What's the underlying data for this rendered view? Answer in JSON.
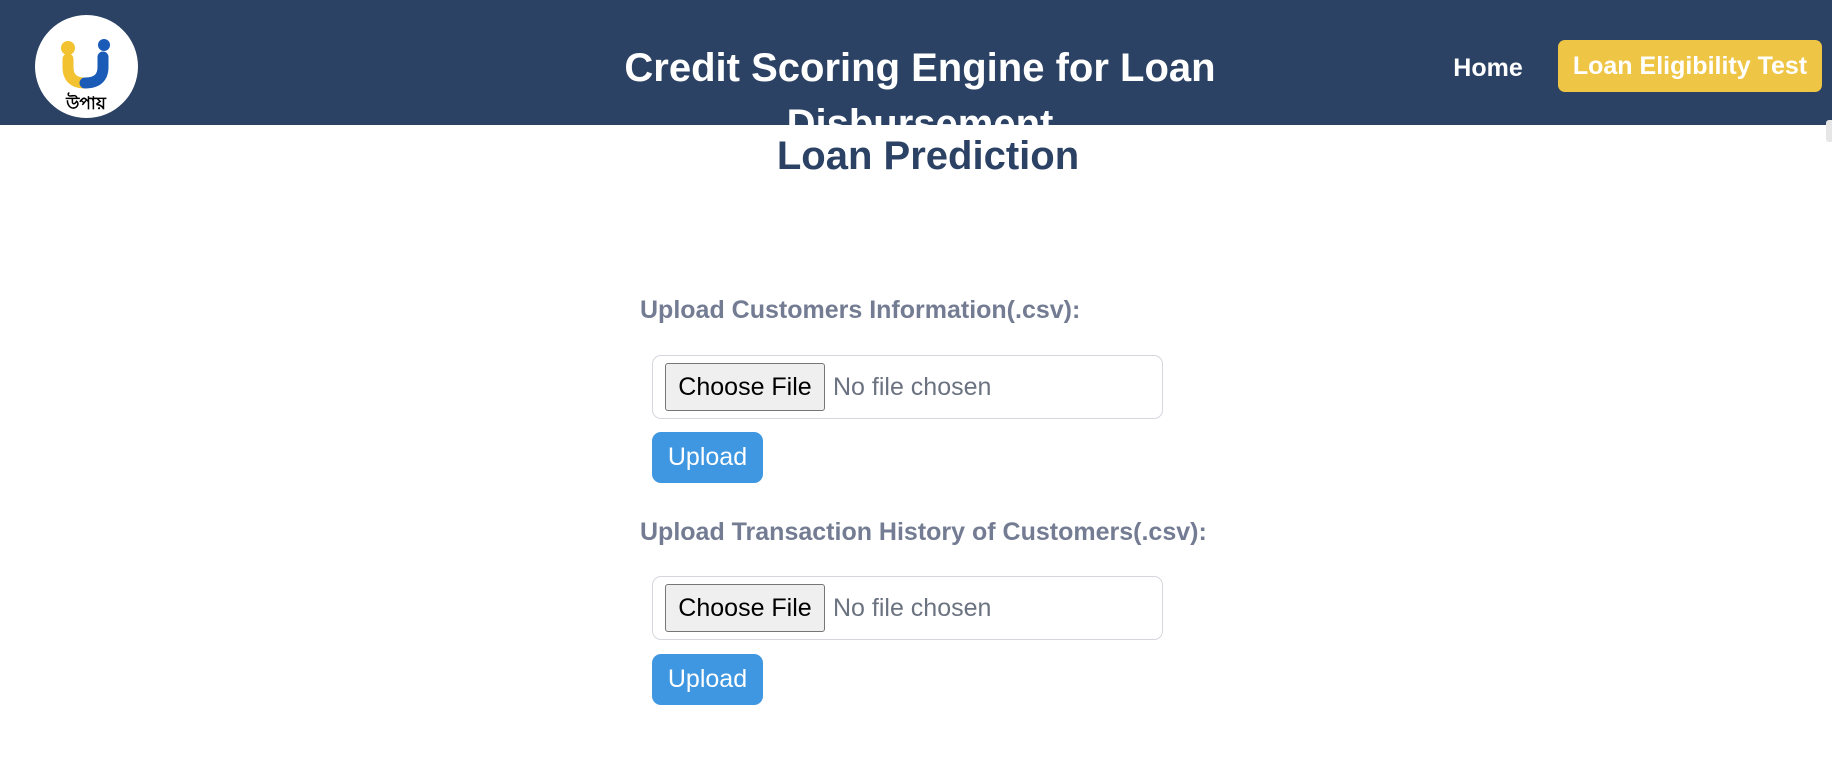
{
  "header": {
    "logo_text": "উপায়",
    "title": "Credit Scoring Engine for Loan Disbursement",
    "nav": {
      "home": "Home",
      "eligibility": "Loan Eligibility Test"
    }
  },
  "main": {
    "title": "Loan Prediction",
    "uploads": [
      {
        "label": "Upload Customers Information(.csv):",
        "choose_label": "Choose File",
        "status": "No file chosen",
        "button": "Upload"
      },
      {
        "label": "Upload Transaction History of Customers(.csv):",
        "choose_label": "Choose File",
        "status": "No file chosen",
        "button": "Upload"
      }
    ]
  },
  "colors": {
    "header_bg": "#2b4264",
    "accent_yellow": "#eec545",
    "upload_blue": "#3e97e0",
    "logo_blue": "#1a5bb8",
    "logo_yellow": "#f2c230",
    "label_gray": "#737c92"
  },
  "icons": {
    "logo": "upay-logo-icon"
  }
}
